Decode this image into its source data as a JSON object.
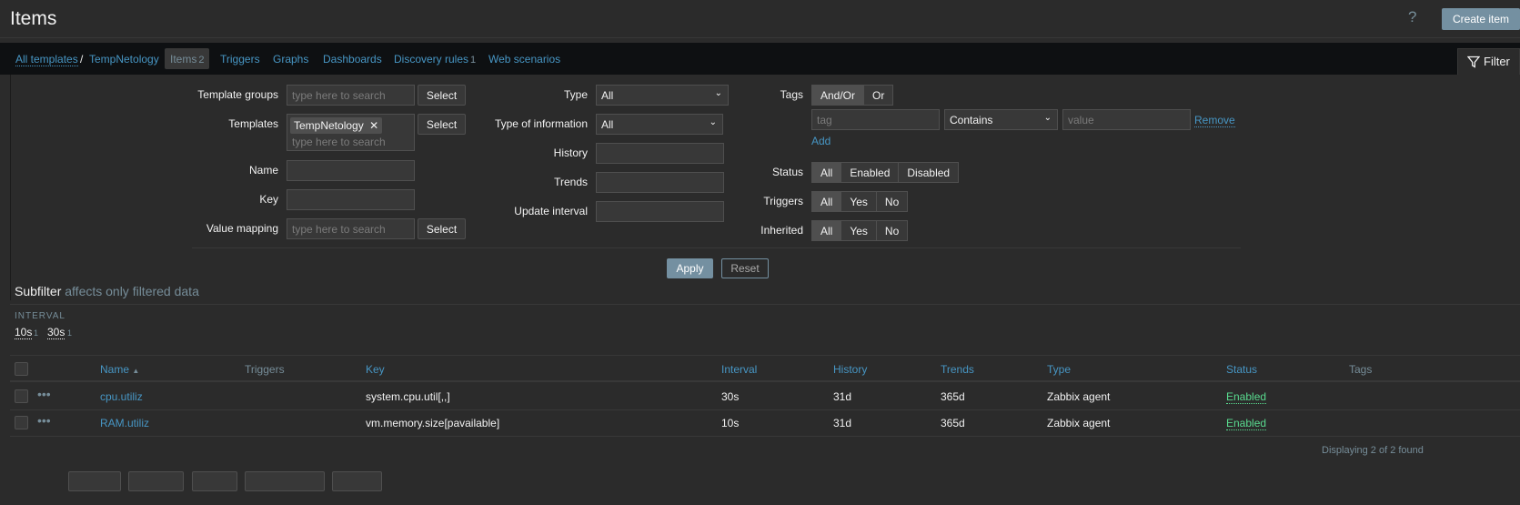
{
  "header": {
    "title": "Items",
    "help_icon": "?",
    "create_label": "Create item"
  },
  "nav": {
    "all_templates": "All templates",
    "separator": "/",
    "template": "TempNetology",
    "items": "Items",
    "items_count": "2",
    "triggers": "Triggers",
    "graphs": "Graphs",
    "dashboards": "Dashboards",
    "discovery": "Discovery rules",
    "discovery_count": "1",
    "web": "Web scenarios",
    "filter_label": "Filter"
  },
  "filter": {
    "template_groups_label": "Template groups",
    "templates_label": "Templates",
    "name_label": "Name",
    "key_label": "Key",
    "value_mapping_label": "Value mapping",
    "search_placeholder": "type here to search",
    "select_label": "Select",
    "template_chip": "TempNetology",
    "type_label": "Type",
    "type_value": "All",
    "type_info_label": "Type of information",
    "type_info_value": "All",
    "history_label": "History",
    "trends_label": "Trends",
    "update_interval_label": "Update interval",
    "tags_label": "Tags",
    "tags_andor": "And/Or",
    "tags_or": "Or",
    "tag_placeholder": "tag",
    "tag_operator": "Contains",
    "value_placeholder": "value",
    "remove_label": "Remove",
    "add_label": "Add",
    "status_label": "Status",
    "status_options": [
      "All",
      "Enabled",
      "Disabled"
    ],
    "triggers_label": "Triggers",
    "inherited_label": "Inherited",
    "yesno_options": [
      "All",
      "Yes",
      "No"
    ],
    "apply_label": "Apply",
    "reset_label": "Reset"
  },
  "subfilter": {
    "title": "Subfilter",
    "note": "affects only filtered data",
    "interval_head": "INTERVAL",
    "values": [
      {
        "label": "10s",
        "count": "1"
      },
      {
        "label": "30s",
        "count": "1"
      }
    ]
  },
  "table": {
    "headers": {
      "name": "Name",
      "sort_arrow": "▲",
      "triggers": "Triggers",
      "key": "Key",
      "interval": "Interval",
      "history": "History",
      "trends": "Trends",
      "type": "Type",
      "status": "Status",
      "tags": "Tags"
    },
    "rows": [
      {
        "name": "cpu.utiliz",
        "key": "system.cpu.util[,,]",
        "interval": "30s",
        "history": "31d",
        "trends": "365d",
        "type": "Zabbix agent",
        "status": "Enabled"
      },
      {
        "name": "RAM.utiliz",
        "key": "vm.memory.size[pavailable]",
        "interval": "10s",
        "history": "31d",
        "trends": "365d",
        "type": "Zabbix agent",
        "status": "Enabled"
      }
    ],
    "footer": "Displaying 2 of 2 found"
  },
  "colors": {
    "accent": "#4796c4",
    "primary_button": "#7490a1",
    "enabled": "#59db8f",
    "navbar": "#0e1012"
  },
  "icons": {
    "help": "question-icon",
    "filter": "funnel-icon",
    "chip_remove": "close-icon",
    "row_menu": "ellipsis-icon",
    "sort": "sort-up-icon"
  }
}
